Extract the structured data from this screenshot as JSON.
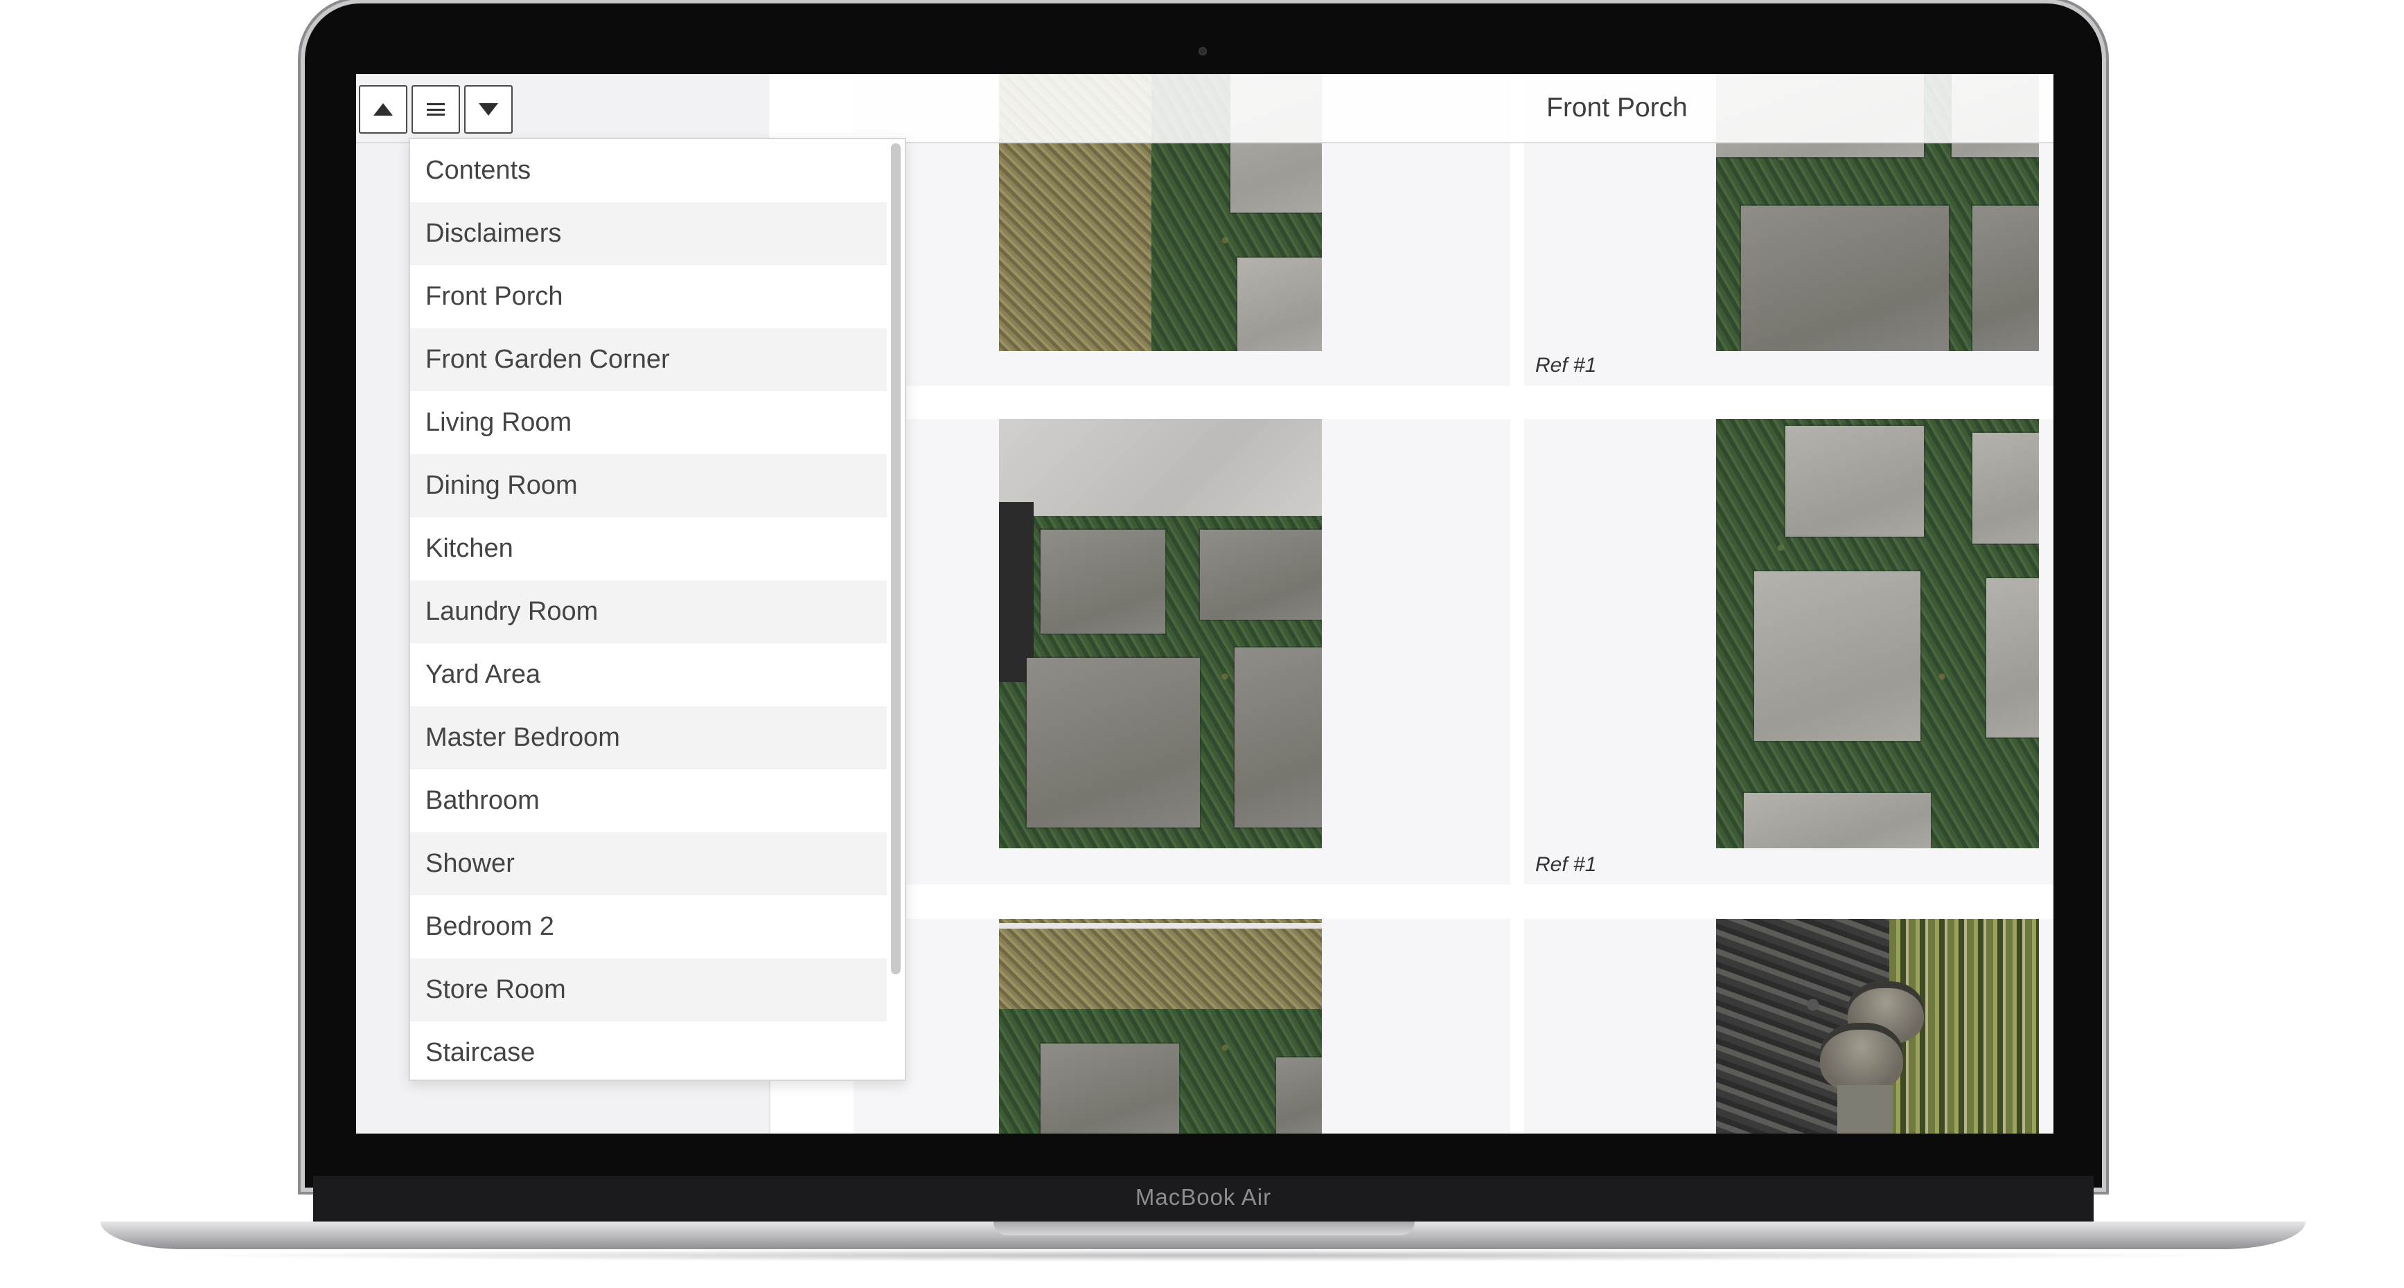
{
  "device": {
    "brand_label": "MacBook Air"
  },
  "header": {
    "title": "Front Porch"
  },
  "nav": {
    "prev_icon": "triangle-up-icon",
    "menu_icon": "hamburger-icon",
    "next_icon": "triangle-down-icon"
  },
  "menu": {
    "items": [
      {
        "label": "Contents"
      },
      {
        "label": "Disclaimers"
      },
      {
        "label": "Front Porch"
      },
      {
        "label": "Front Garden Corner"
      },
      {
        "label": "Living Room"
      },
      {
        "label": "Dining Room"
      },
      {
        "label": "Kitchen"
      },
      {
        "label": "Laundry Room"
      },
      {
        "label": "Yard Area"
      },
      {
        "label": "Master Bedroom"
      },
      {
        "label": "Bathroom"
      },
      {
        "label": "Shower"
      },
      {
        "label": "Bedroom 2"
      },
      {
        "label": "Store Room"
      },
      {
        "label": "Staircase"
      }
    ]
  },
  "photos": {
    "row1_ref": "Ref #1",
    "row2_ref": "Ref #1"
  },
  "colors": {
    "menu_alt_row": "#f3f3f4",
    "card_bg": "#f6f6f8",
    "title_text": "#3d3d3f"
  }
}
